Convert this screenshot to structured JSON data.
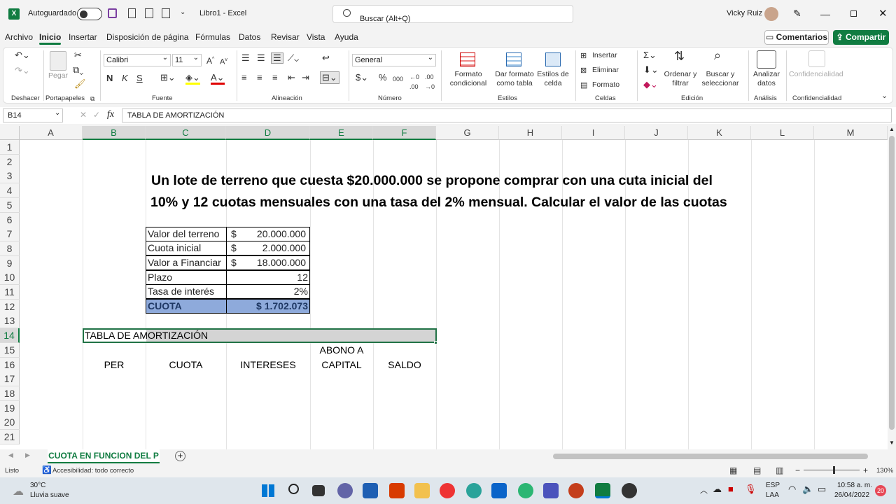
{
  "titlebar": {
    "autosave_label": "Autoguardado",
    "doc_title": "Libro1  -  Excel",
    "search_placeholder": "Buscar (Alt+Q)",
    "user_name": "Vicky Ruiz"
  },
  "menu": {
    "items": [
      "Archivo",
      "Inicio",
      "Insertar",
      "Disposición de página",
      "Fórmulas",
      "Datos",
      "Revisar",
      "Vista",
      "Ayuda"
    ],
    "active": "Inicio",
    "comments_label": "Comentarios",
    "share_label": "Compartir"
  },
  "ribbon": {
    "undo_label": "Deshacer",
    "clipboard_label": "Portapapeles",
    "paste_label": "Pegar",
    "font_label": "Fuente",
    "font_name": "Calibri",
    "font_size": "11",
    "alignment_label": "Alineación",
    "number_label": "Número",
    "number_format": "General",
    "styles_label": "Estilos",
    "cond_format": "Formato condicional",
    "format_table": "Dar formato como tabla",
    "cell_styles": "Estilos de celda",
    "cells_label": "Celdas",
    "insert": "Insertar",
    "delete": "Eliminar",
    "format": "Formato",
    "editing_label": "Edición",
    "sort_filter": "Ordenar y filtrar",
    "find_select": "Buscar y seleccionar",
    "analysis_label": "Análisis",
    "analyze_data": "Analizar datos",
    "confidentiality_label": "Confidencialidad",
    "confidentiality_btn": "Confidencialidad"
  },
  "formula_bar": {
    "name_box": "B14",
    "formula": "TABLA DE AMORTIZACIÓN"
  },
  "grid": {
    "columns": [
      "A",
      "B",
      "C",
      "D",
      "E",
      "F",
      "G",
      "H",
      "I",
      "J",
      "K",
      "L",
      "M"
    ],
    "rows": [
      "1",
      "2",
      "3",
      "4",
      "5",
      "6",
      "7",
      "8",
      "9",
      "10",
      "11",
      "12",
      "13",
      "14",
      "15",
      "16",
      "17",
      "18",
      "19",
      "20",
      "21"
    ],
    "problem_line1": "Un lote de terreno que cuesta $20.000.000 se propone comprar con una cuta inicial del",
    "problem_line2": "10% y 12 cuotas mensuales con una tasa del 2% mensual. Calcular el valor de las cuotas",
    "table": [
      {
        "label": "Valor del terreno",
        "currency": "$",
        "value": "20.000.000"
      },
      {
        "label": "Cuota inicial",
        "currency": "$",
        "value": "2.000.000"
      },
      {
        "label": "Valor a Financiar",
        "currency": "$",
        "value": "18.000.000"
      },
      {
        "label": "Plazo",
        "currency": "",
        "value": "12"
      },
      {
        "label": "Tasa de interés",
        "currency": "",
        "value": "2%"
      },
      {
        "label": "CUOTA",
        "currency": "",
        "value": "$ 1.702.073"
      }
    ],
    "amort_title": "TABLA DE AMORTIZACIÓN",
    "headers": {
      "per": "PER",
      "cuota": "CUOTA",
      "intereses": "INTERESES",
      "abono1": "ABONO A",
      "abono2": "CAPITAL",
      "saldo": "SALDO"
    }
  },
  "sheet_tab": "CUOTA EN FUNCION DEL P",
  "status": {
    "ready": "Listo",
    "accessibility": "Accesibilidad: todo correcto",
    "zoom": "130%"
  },
  "taskbar": {
    "temp": "30°C",
    "weather": "Lluvia suave",
    "lang1": "ESP",
    "lang2": "LAA",
    "time": "10:58 a. m.",
    "date": "26/04/2022",
    "badge": "20"
  },
  "colors": {
    "excel_green": "#107c41",
    "cuota_fill": "#8eaadb",
    "cuota_text": "#1f3864"
  }
}
